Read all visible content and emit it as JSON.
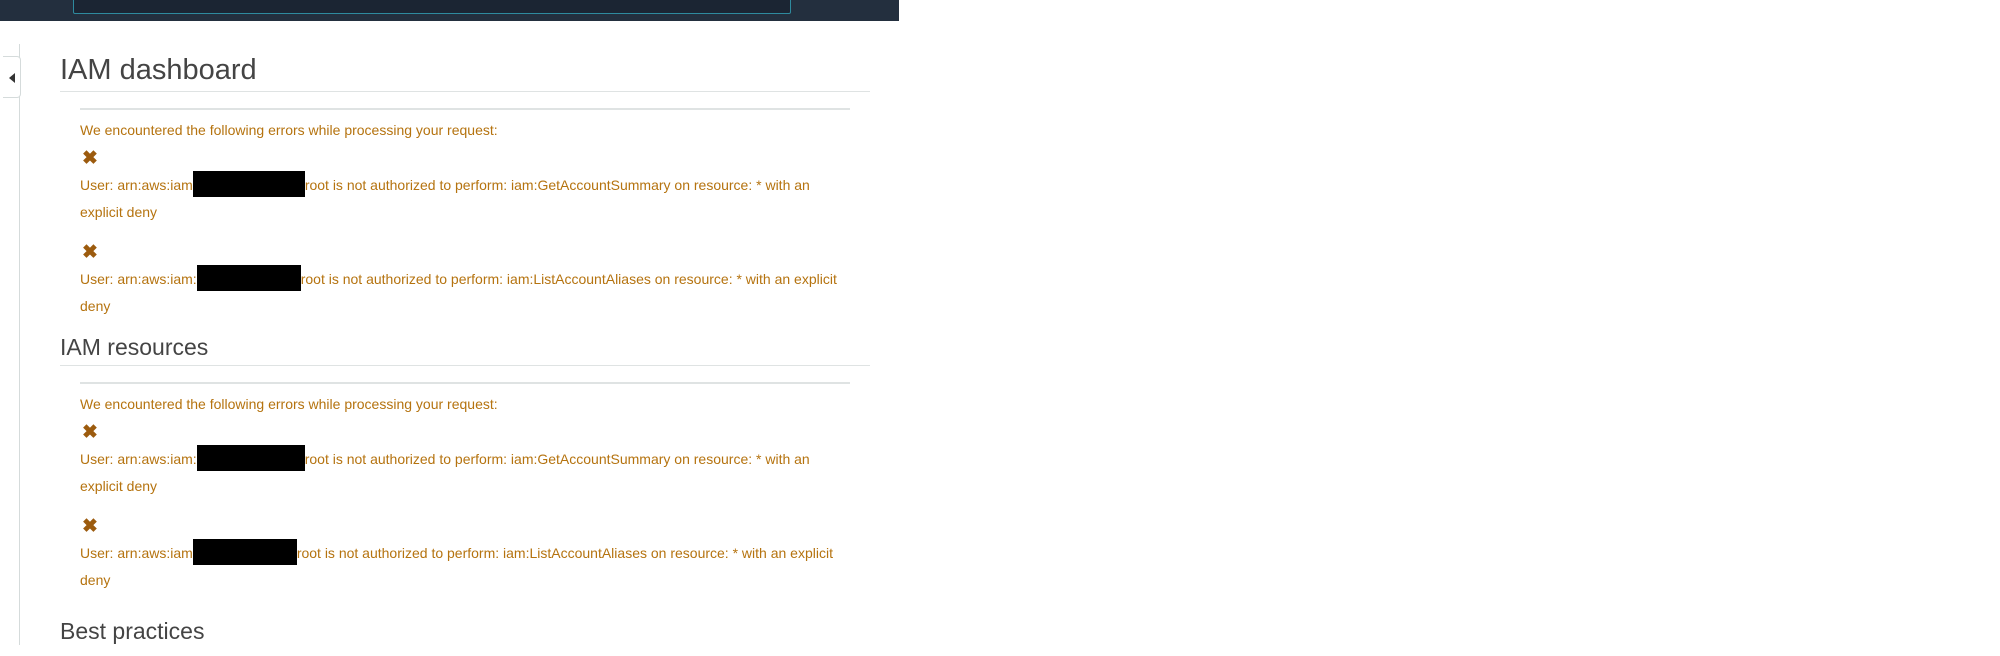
{
  "header": {
    "search_value": ""
  },
  "sidebar": {
    "toggle_icon": "caret-left-icon"
  },
  "colors": {
    "topbar": "#232f3e",
    "error_text": "#b5730f",
    "heading": "#444444"
  },
  "sections": [
    {
      "title": "IAM dashboard",
      "alert": {
        "lead": "We encountered the following errors while processing your request:",
        "errors": [
          {
            "icon": "x-error-icon",
            "prefix": "User: arn:aws:iam",
            "suffix": "root is not authorized to perform: iam:GetAccountSummary on resource: * with an explicit deny"
          },
          {
            "icon": "x-error-icon",
            "prefix": "User: arn:aws:iam:",
            "suffix": "root is not authorized to perform: iam:ListAccountAliases on resource: * with an explicit deny"
          }
        ]
      }
    },
    {
      "title": "IAM resources",
      "alert": {
        "lead": "We encountered the following errors while processing your request:",
        "errors": [
          {
            "icon": "x-error-icon",
            "prefix": "User: arn:aws:iam:",
            "suffix": "root is not authorized to perform: iam:GetAccountSummary on resource: * with an explicit deny"
          },
          {
            "icon": "x-error-icon",
            "prefix": "User: arn:aws:iam",
            "suffix": "root is not authorized to perform: iam:ListAccountAliases on resource: * with an explicit deny"
          }
        ]
      }
    },
    {
      "title": "Best practices"
    }
  ]
}
